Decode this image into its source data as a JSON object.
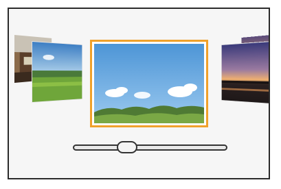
{
  "thumbnails": [
    {
      "id": "far-left",
      "scene": "city-tram"
    },
    {
      "id": "near-left",
      "scene": "green-field-sky"
    },
    {
      "id": "center",
      "scene": "blue-sky-clouds-trees",
      "selected": true
    },
    {
      "id": "near-right",
      "scene": "sunset-lake"
    },
    {
      "id": "far-right",
      "scene": "sunset-lake"
    }
  ],
  "slider": {
    "position_fraction": 0.33
  },
  "colors": {
    "selection_border": "#f0a12a",
    "frame_border": "#2a2a2a",
    "background": "#f6f6f6"
  }
}
